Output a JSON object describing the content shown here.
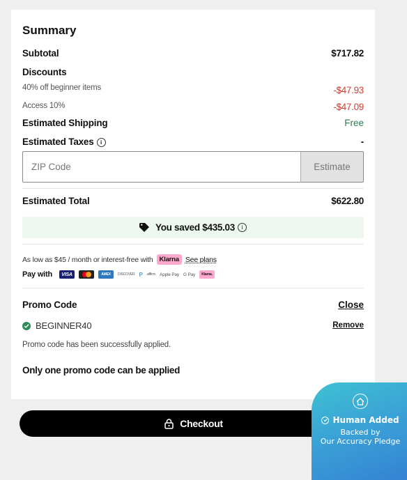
{
  "summary": {
    "title": "Summary",
    "subtotal_label": "Subtotal",
    "subtotal_value": "$717.82",
    "discounts_label": "Discounts",
    "discount_items": [
      {
        "label": "40% off beginner items",
        "value": "-$47.93"
      },
      {
        "label": "Access 10%",
        "value": "-$47.09"
      }
    ],
    "shipping_label": "Estimated Shipping",
    "shipping_value": "Free",
    "taxes_label": "Estimated Taxes",
    "taxes_value": "-",
    "zip_placeholder": "ZIP Code",
    "estimate_label": "Estimate",
    "total_label": "Estimated Total",
    "total_value": "$622.80",
    "saved_text": "You saved $435.03"
  },
  "financing": {
    "text": "As low as $45 / month or interest-free with",
    "klarna_label": "Klarna",
    "see_plans": "See plans",
    "pay_with_label": "Pay with",
    "payment_methods": [
      "VISA",
      "mastercard",
      "AMEX",
      "DISCOVER",
      "PayPal",
      "affirm",
      "Apple Pay",
      "G Pay",
      "Klarna."
    ]
  },
  "promo": {
    "title": "Promo Code",
    "close_label": "Close",
    "code": "BEGINNER40",
    "remove_label": "Remove",
    "applied_message": "Promo code has been successfully applied.",
    "one_code_note": "Only one promo code can be applied"
  },
  "checkout": {
    "label": "Checkout"
  },
  "badge": {
    "headline": "Human Added",
    "line1": "Backed by",
    "line2": "Our Accuracy Pledge"
  },
  "colors": {
    "discount_red": "#d0403a",
    "free_green": "#2c7a52",
    "saved_bg": "#eef7f0",
    "klarna_pink": "#ffa8cd",
    "badge_blue": "#3aa2d6"
  }
}
